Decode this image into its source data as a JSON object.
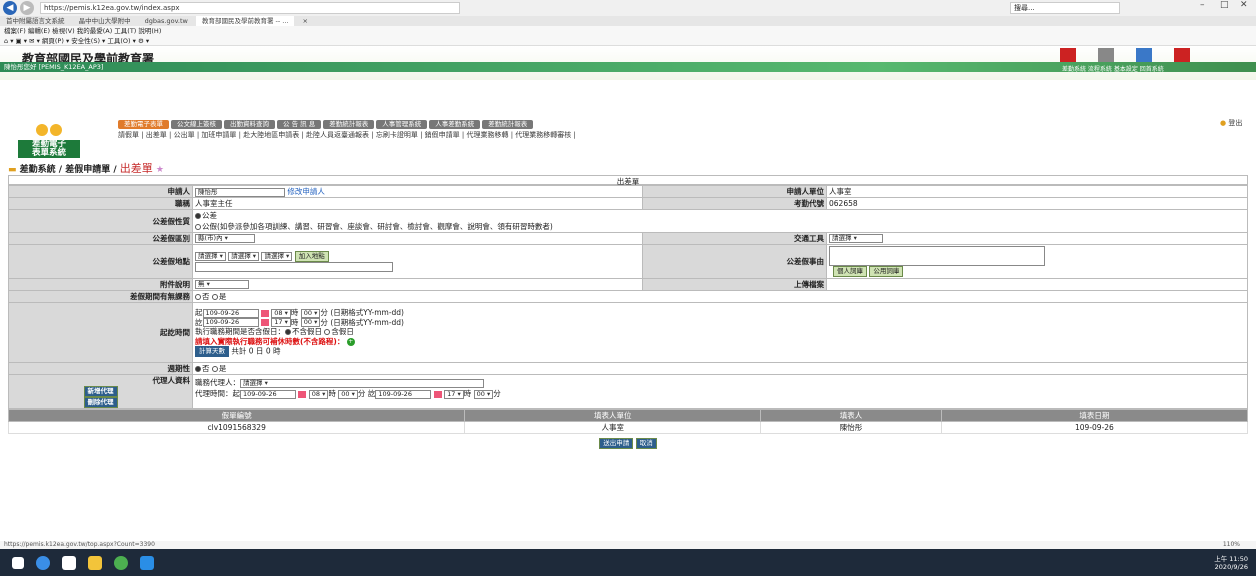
{
  "browser": {
    "url": "https://pemis.k12ea.gov.tw/index.aspx",
    "search_placeholder": "搜尋...",
    "zoom": "110%",
    "tabs": [
      "首中附屬語言文系統",
      "晶中中山大學附中",
      "dgbas.gov.tw",
      "教育部國民及學前教育署 -- ...",
      "×"
    ],
    "menu": "檔案(F)  編輯(E)  檢視(V)  我的最愛(A)  工具(T)  說明(H)",
    "toolbar": "⌂ ▾ ▣ ▾ ✉ ▾ 網頁(P) ▾ 安全性(S) ▾ 工具(O) ▾ ⚙ ▾"
  },
  "site": {
    "title": "教育部國民及學前教育署",
    "user": "陳怡彤您好 [PEMIS_K12EA_AP3]",
    "top_icons": "差勤系統  流程系統  基本設定  回首系統",
    "logo_text1": "差勤電子",
    "logo_text2": "表單系統",
    "modules": [
      "差勤電子表單",
      "公文線上簽核",
      "出勤資料查詢",
      "公 告 訊 息",
      "差勤統計報表",
      "人事管理系統",
      "人事差勤系統",
      "差勤統計報表"
    ],
    "sublinks": "請假單 | 出差單 | 公出單 | 加班申請單 | 赴大陸地區申請表 | 赴陸人員返臺通報表 | 忘刷卡證明單 | 銷假申請單 | 代理業務移轉 | 代理業務移轉審核 |",
    "logout": "登出",
    "crumb_path": "差勤系統 / 差假申請單 / ",
    "crumb_current": "出差單"
  },
  "form": {
    "caption": "出差單",
    "applicant_label": "申請人",
    "applicant_value": "陳怡彤",
    "change_applicant": "修改申請人",
    "unit_label": "申請人單位",
    "unit_value": "人事室",
    "title_label": "職稱",
    "title_value": "人事室主任",
    "code_label": "考勤代號",
    "code_value": "062658",
    "nature_label": "公差假性質",
    "nature_opt1": "公差",
    "nature_opt2": "公假(如參派參加各項訓練、講習、研習會、座談會、研討會、檢討會、觀摩會、說明會、領有研習時數者)",
    "area_label": "公差假區別",
    "area_value": "縣(市)內",
    "transport_label": "交通工具",
    "transport_value": "請選擇",
    "place_label": "公差假地點",
    "select1": "請選擇",
    "select2": "請選擇",
    "select3": "請選擇",
    "add_place": "加入地點",
    "reason_label": "公差假事由",
    "personal_phrase": "個人詞庫",
    "common_phrase": "公用詞庫",
    "attach_label": "附件說明",
    "attach_value": "無",
    "upload_label": "上傳檔案",
    "holiday_label": "差假期間有無課務",
    "no": "否",
    "yes": "是",
    "time_label": "起訖時間",
    "start_prefix": "起",
    "start_date": "109-09-26",
    "start_hour": "08",
    "start_min": "00",
    "hour_unit": "時",
    "min_unit": "分",
    "date_fmt": "(日期格式YY-mm-dd)",
    "end_prefix": "訖",
    "end_date": "109-09-26",
    "end_hour": "17",
    "end_min": "00",
    "holiday_q": "執行職務期間是否含假日：",
    "not_include": "不含假日",
    "include": "含假日",
    "warn": "請填入實際執行職務可補休時數(不含路程)：",
    "calc_btn": "計算天數",
    "total": "共計 0 日 0 時",
    "cycle_label": "週期性",
    "agent_label": "代理人資料",
    "add_proxy": "新增代理",
    "del_proxy": "刪除代理",
    "agent_name_label": "職務代理人：",
    "agent_name_value": "請選擇",
    "agent_time_label": "代理時間：起",
    "agent_start_date": "109-09-26",
    "agent_start_hour": "08",
    "agent_start_min": "00",
    "agent_end_prefix": "訖",
    "agent_end_date": "109-09-26",
    "agent_end_hour": "17",
    "agent_end_min": "00"
  },
  "records": {
    "headers": [
      "假單編號",
      "填表人單位",
      "填表人",
      "填表日期"
    ],
    "rows": [
      [
        "clv1091568329",
        "人事室",
        "陳怡彤",
        "109-09-26"
      ]
    ]
  },
  "actions": {
    "submit": "送出申請",
    "cancel": "取消"
  },
  "status": "https://pemis.k12ea.gov.tw/top.aspx?Count=3390",
  "clock": {
    "time": "上午 11:50",
    "date": "2020/9/26"
  }
}
